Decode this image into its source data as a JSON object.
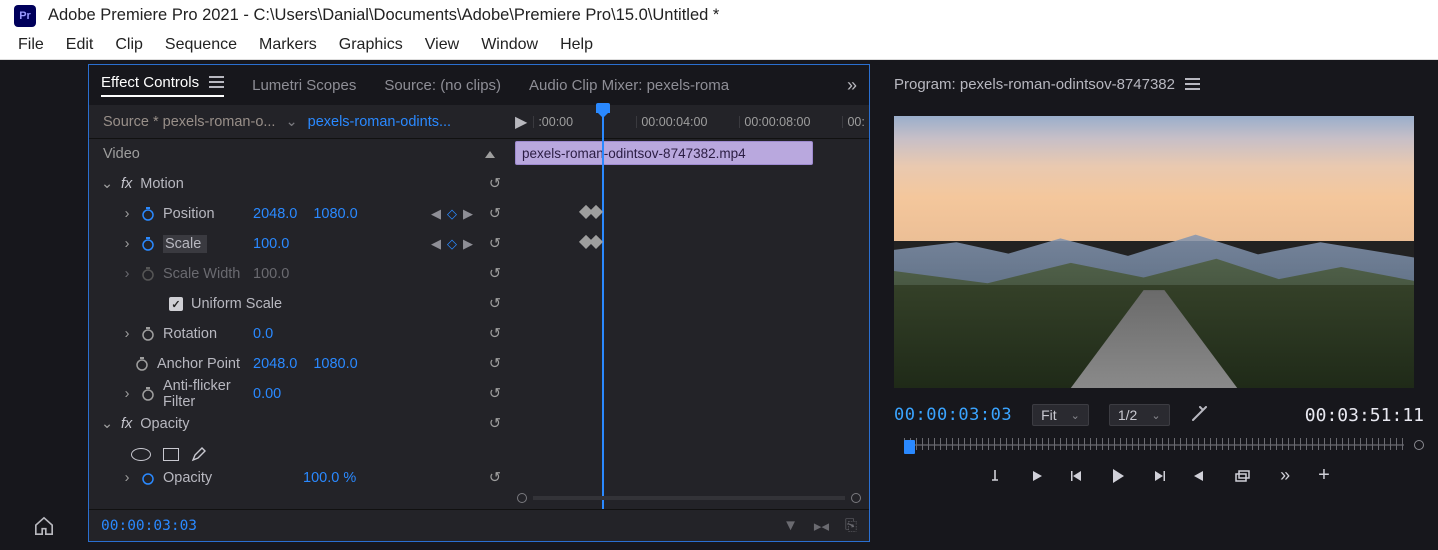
{
  "title": "Adobe Premiere Pro 2021 - C:\\Users\\Danial\\Documents\\Adobe\\Premiere Pro\\15.0\\Untitled *",
  "appicon_text": "Pr",
  "menu": [
    "File",
    "Edit",
    "Clip",
    "Sequence",
    "Markers",
    "Graphics",
    "View",
    "Window",
    "Help"
  ],
  "panel_tabs": {
    "effect_controls": "Effect Controls",
    "lumetri": "Lumetri Scopes",
    "source": "Source: (no clips)",
    "audio_mixer": "Audio Clip Mixer: pexels-roma"
  },
  "ec": {
    "source_name": "Source * pexels-roman-o...",
    "sequence_link": "pexels-roman-odints...",
    "ruler": [
      ":00:00",
      "00:00:04:00",
      "00:00:08:00",
      "00:"
    ],
    "video_label": "Video",
    "clip_label": "pexels-roman-odintsov-8747382.mp4",
    "motion_label": "Motion",
    "position": {
      "label": "Position",
      "x": "2048.0",
      "y": "1080.0"
    },
    "scale": {
      "label": "Scale",
      "v": "100.0"
    },
    "scale_width": {
      "label": "Scale Width",
      "v": "100.0"
    },
    "uniform_label": "Uniform Scale",
    "rotation": {
      "label": "Rotation",
      "v": "0.0"
    },
    "anchor": {
      "label": "Anchor Point",
      "x": "2048.0",
      "y": "1080.0"
    },
    "antiflicker": {
      "label": "Anti-flicker Filter",
      "v": "0.00"
    },
    "opacity_label": "Opacity",
    "opacity_row": {
      "label": "Opacity",
      "v": "100.0 %"
    },
    "timecode": "00:00:03:03"
  },
  "program": {
    "title": "Program: pexels-roman-odintsov-8747382",
    "timecode": "00:00:03:03",
    "fit_label": "Fit",
    "res_label": "1/2",
    "duration": "00:03:51:11"
  }
}
